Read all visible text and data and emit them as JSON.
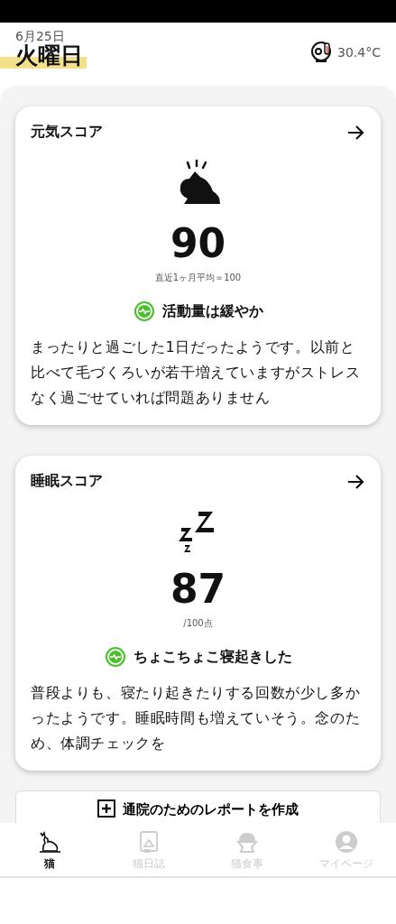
{
  "header": {
    "date": "6月25日",
    "weekday": "火曜日",
    "temperature": "30.4°C"
  },
  "cards": [
    {
      "kind": "activity",
      "title": "元気スコア",
      "score": "90",
      "score_note": "直近1ヶ月平均＝100",
      "status": "活動量は緩やか",
      "description": "まったりと過ごした1日だったようです。以前と比べて毛づくろいが若干増えていますがストレスなく過ごせていれば問題ありません"
    },
    {
      "kind": "sleep",
      "title": "睡眠スコア",
      "score": "87",
      "score_note": "/100点",
      "status": "ちょこちょこ寝起きした",
      "description": "普段よりも、寝たり起きたりする回数が少し多かったようです。睡眠時間も増えていそう。念のため、体調チェックを"
    }
  ],
  "report_button": {
    "label": "通院のためのレポートを作成"
  },
  "nav_tabs": [
    {
      "kind": "cat",
      "label": "猫",
      "selected": true
    },
    {
      "kind": "diary",
      "label": "猫日誌",
      "selected": false
    },
    {
      "kind": "food",
      "label": "猫食事",
      "selected": false
    },
    {
      "kind": "mypage",
      "label": "マイページ",
      "selected": false
    }
  ]
}
